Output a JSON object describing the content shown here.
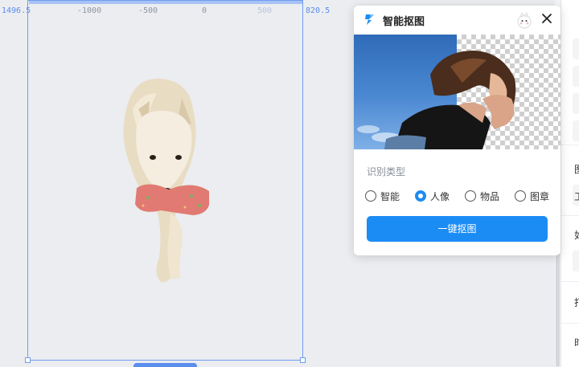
{
  "ruler": {
    "ticks": [
      "1496.5",
      "-1000",
      "-500",
      "0",
      "500",
      "820.5"
    ]
  },
  "popup": {
    "title": "智能抠图",
    "section_label": "识别类型",
    "options": [
      {
        "label": "智能",
        "selected": false
      },
      {
        "label": "人像",
        "selected": true
      },
      {
        "label": "物品",
        "selected": false
      },
      {
        "label": "图章",
        "selected": false
      }
    ],
    "primary_button": "一键抠图"
  },
  "side_panel": {
    "chars": [
      "图",
      "工",
      "如",
      "打",
      "时"
    ]
  },
  "colors": {
    "accent": "#1c8cf5",
    "selection": "#6f9cf0",
    "canvas_bg": "#ebedf0"
  },
  "icons": [
    "app-logo-icon",
    "mascot-icon",
    "close-icon"
  ]
}
